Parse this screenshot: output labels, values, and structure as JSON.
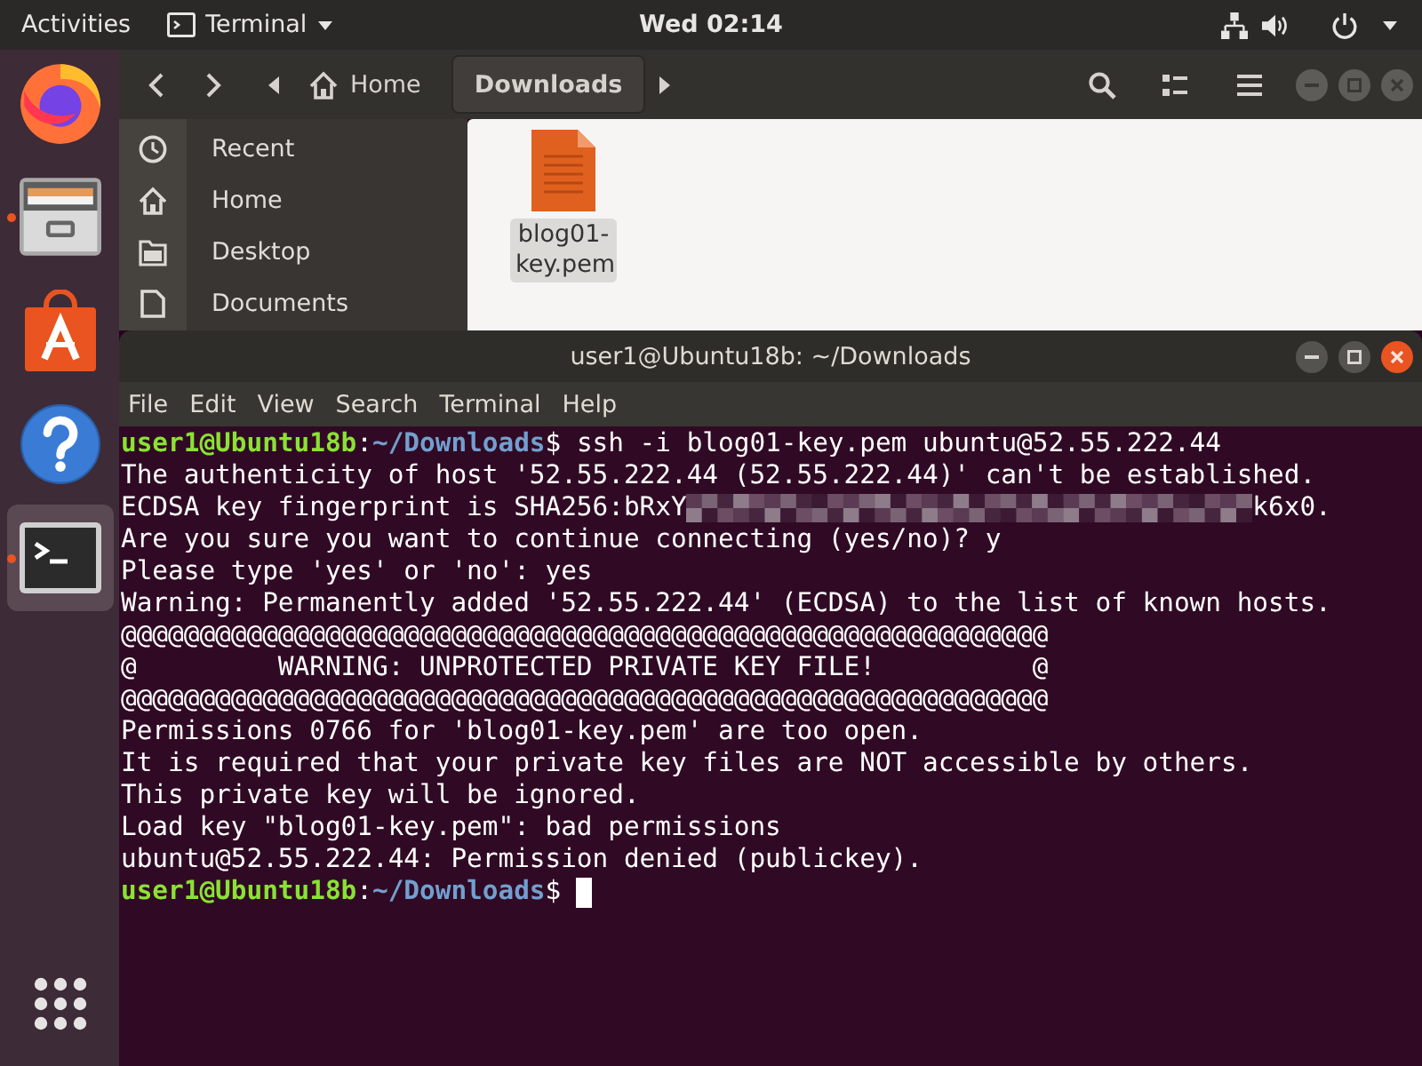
{
  "top_bar": {
    "activities": "Activities",
    "app_menu": "Terminal",
    "clock": "Wed 02:14"
  },
  "dock": {
    "items": [
      {
        "kind": "browser",
        "selected": false,
        "running": false
      },
      {
        "kind": "files",
        "selected": false,
        "running": true
      },
      {
        "kind": "software",
        "selected": false,
        "running": false
      },
      {
        "kind": "help",
        "selected": false,
        "running": false
      },
      {
        "kind": "terminal",
        "selected": true,
        "running": true
      }
    ]
  },
  "file_manager": {
    "focused": false,
    "path": [
      {
        "kind": "home",
        "label": "Home",
        "selected": false
      },
      {
        "kind": "folder",
        "label": "Downloads",
        "selected": true
      }
    ],
    "sidebar": [
      {
        "kind": "recent",
        "label": "Recent"
      },
      {
        "kind": "home",
        "label": "Home"
      },
      {
        "kind": "desktop",
        "label": "Desktop"
      },
      {
        "kind": "documents",
        "label": "Documents"
      }
    ],
    "files": [
      {
        "name": "blog01-key.pem",
        "selected": true
      }
    ]
  },
  "terminal": {
    "focused": true,
    "title": "user1@Ubuntu18b: ~/Downloads",
    "menu": [
      "File",
      "Edit",
      "View",
      "Search",
      "Terminal",
      "Help"
    ],
    "lines": [
      {
        "kind": "prompt",
        "user": "user1@Ubuntu18b",
        "separator": ":",
        "path": "~/Downloads",
        "symbol": "$",
        "command": "ssh -i blog01-key.pem ubuntu@52.55.222.44",
        "cursor": false
      },
      {
        "kind": "output",
        "text": "The authenticity of host '52.55.222.44 (52.55.222.44)' can't be established."
      },
      {
        "kind": "redacted",
        "text": "ECDSA key fingerprint is SHA256:bRxY",
        "after": "k6x0."
      },
      {
        "kind": "output",
        "text": "Are you sure you want to continue connecting (yes/no)? y"
      },
      {
        "kind": "output",
        "text": "Please type 'yes' or 'no': yes"
      },
      {
        "kind": "output",
        "text": "Warning: Permanently added '52.55.222.44' (ECDSA) to the list of known hosts."
      },
      {
        "kind": "output",
        "text": "@@@@@@@@@@@@@@@@@@@@@@@@@@@@@@@@@@@@@@@@@@@@@@@@@@@@@@@@@@@"
      },
      {
        "kind": "output",
        "text": "@         WARNING: UNPROTECTED PRIVATE KEY FILE!          @"
      },
      {
        "kind": "output",
        "text": "@@@@@@@@@@@@@@@@@@@@@@@@@@@@@@@@@@@@@@@@@@@@@@@@@@@@@@@@@@@"
      },
      {
        "kind": "output",
        "text": "Permissions 0766 for 'blog01-key.pem' are too open."
      },
      {
        "kind": "output",
        "text": "It is required that your private key files are NOT accessible by others."
      },
      {
        "kind": "output",
        "text": "This private key will be ignored."
      },
      {
        "kind": "output",
        "text": "Load key \"blog01-key.pem\": bad permissions"
      },
      {
        "kind": "output",
        "text": "ubuntu@52.55.222.44: Permission denied (publickey)."
      },
      {
        "kind": "prompt",
        "user": "user1@Ubuntu18b",
        "separator": ":",
        "path": "~/Downloads",
        "symbol": "$",
        "cursor": true
      }
    ]
  }
}
